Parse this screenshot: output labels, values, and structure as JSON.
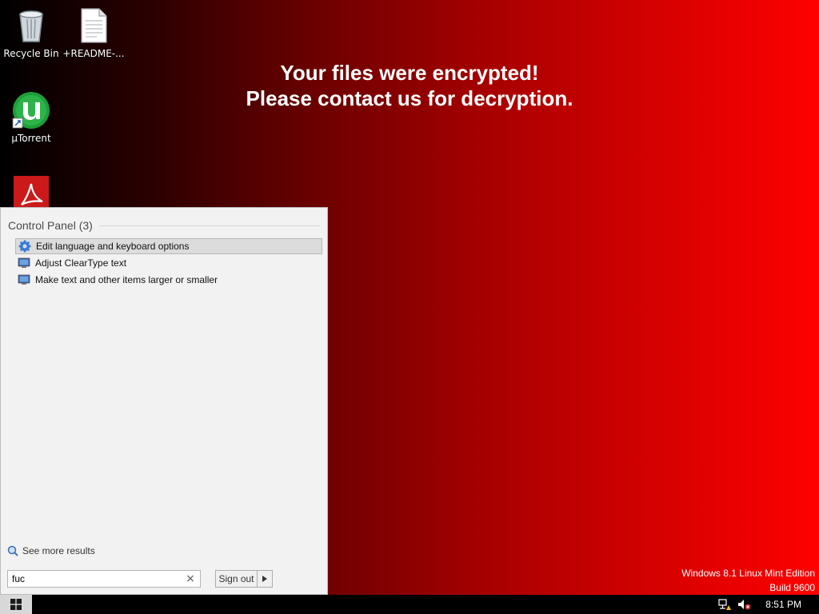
{
  "desktop": {
    "icons": [
      {
        "label": "Recycle Bin",
        "icon": "recycle-bin-icon"
      },
      {
        "label": "+README-...",
        "icon": "text-document-icon"
      },
      {
        "label": "µTorrent",
        "icon": "utorrent-icon"
      },
      {
        "label": "",
        "icon": "adobe-reader-icon"
      }
    ]
  },
  "ransom_message": {
    "line1": "Your files were encrypted!",
    "line2": "Please contact us for decryption."
  },
  "watermark": {
    "edition": "Windows 8.1 Linux Mint Edition",
    "build": "Build 9600"
  },
  "start_menu": {
    "group_title": "Control Panel (3)",
    "results": [
      {
        "label": "Edit language and keyboard options",
        "icon": "gear-icon",
        "selected": true
      },
      {
        "label": "Adjust ClearType text",
        "icon": "monitor-icon",
        "selected": false
      },
      {
        "label": "Make text and other items larger or smaller",
        "icon": "monitor-icon",
        "selected": false
      }
    ],
    "see_more": "See more results",
    "search_value": "fuc",
    "clear_symbol": "×",
    "sign_out": "Sign out"
  },
  "taskbar": {
    "clock": "8:51 PM"
  },
  "colors": {
    "background_left": "#000000",
    "background_right": "#ff0000",
    "menu_bg": "#f2f2f2",
    "selected_bg": "#dcdcdc"
  }
}
